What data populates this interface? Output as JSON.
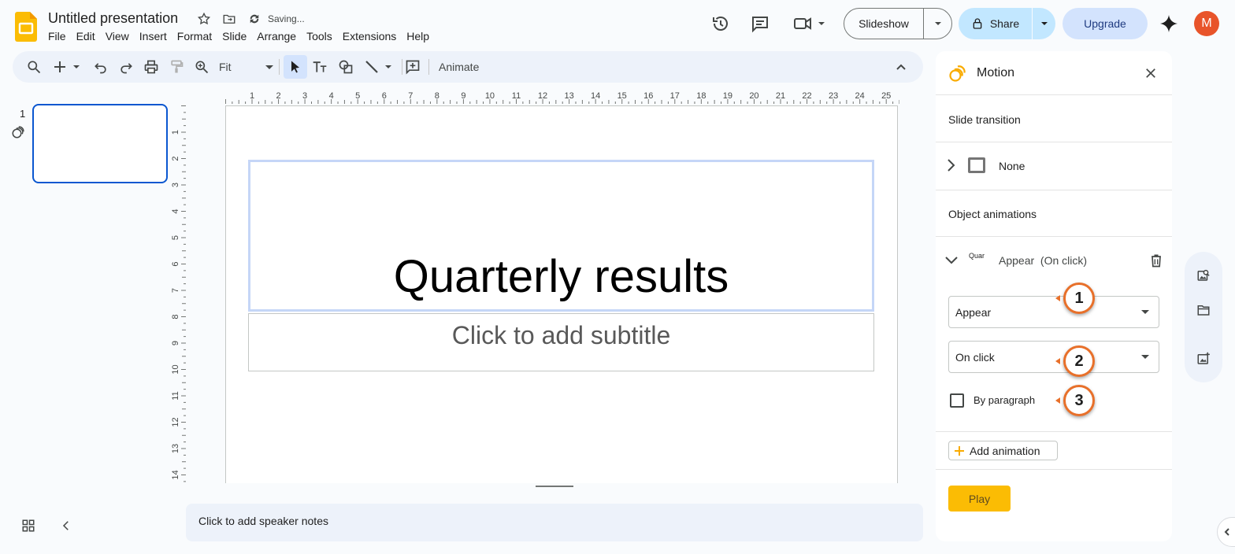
{
  "header": {
    "doc_title": "Untitled presentation",
    "saving_status": "Saving...",
    "menu": [
      "File",
      "Edit",
      "View",
      "Insert",
      "Format",
      "Slide",
      "Arrange",
      "Tools",
      "Extensions",
      "Help"
    ],
    "slideshow_label": "Slideshow",
    "share_label": "Share",
    "upgrade_label": "Upgrade",
    "avatar_letter": "M"
  },
  "toolbar": {
    "zoom_label": "Fit",
    "animate_label": "Animate"
  },
  "filmstrip": {
    "slide_number": "1"
  },
  "ruler": {
    "h_ticks": [
      "1",
      "2",
      "3",
      "4",
      "5",
      "6",
      "7",
      "8",
      "9",
      "10",
      "11",
      "12",
      "13",
      "14",
      "15",
      "16",
      "17",
      "18",
      "19",
      "20",
      "21",
      "22",
      "23",
      "24",
      "25"
    ],
    "v_ticks": [
      "1",
      "2",
      "3",
      "4",
      "5",
      "6",
      "7",
      "8",
      "9",
      "10",
      "11",
      "12",
      "13",
      "14"
    ]
  },
  "slide": {
    "title": "Quarterly results",
    "subtitle_placeholder": "Click to add subtitle"
  },
  "notes": {
    "placeholder": "Click to add speaker notes"
  },
  "motion_panel": {
    "title": "Motion",
    "slide_transition_heading": "Slide transition",
    "transition_value": "None",
    "object_animations_heading": "Object animations",
    "animation_object_label": "Quar",
    "animation_summary": "Appear  (On click)",
    "effect_value": "Appear",
    "trigger_value": "On click",
    "by_paragraph_label": "By paragraph",
    "by_paragraph_checked": false,
    "add_animation_label": "Add animation",
    "play_label": "Play"
  },
  "callouts": [
    "1",
    "2",
    "3"
  ],
  "colors": {
    "accent_blue": "#0b57d0",
    "callout_orange": "#e8702a",
    "play_yellow": "#fbbc04",
    "avatar_orange": "#e8542a"
  }
}
